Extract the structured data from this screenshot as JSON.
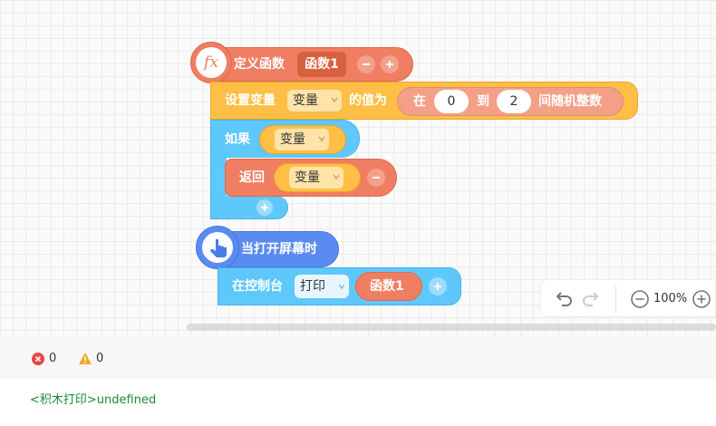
{
  "workspace": {
    "func_block": {
      "label": "定义函数",
      "name": "函数1",
      "icon_text": "fx"
    },
    "set_block": {
      "prefix": "设置变量",
      "var": "变量",
      "middle": "的值为",
      "range_start": "在",
      "from": "0",
      "to_label": "到",
      "to": "2",
      "suffix": "间随机整数"
    },
    "if_block": {
      "label": "如果",
      "var": "变量"
    },
    "return_block": {
      "label": "返回",
      "var": "变量"
    },
    "event_block": {
      "label": "当打开屏幕时"
    },
    "console_block": {
      "prefix": "在控制台",
      "action": "打印",
      "func": "函数1"
    }
  },
  "zoom": {
    "level": "100%"
  },
  "status": {
    "errors": "0",
    "warnings": "0"
  },
  "console": {
    "output": "<积木打印>undefined"
  },
  "colors": {
    "function": "#ef7e62",
    "set": "#ffbf46",
    "control": "#5ec8fa",
    "event": "#5a8bf0",
    "console_text": "#1a8a38"
  }
}
